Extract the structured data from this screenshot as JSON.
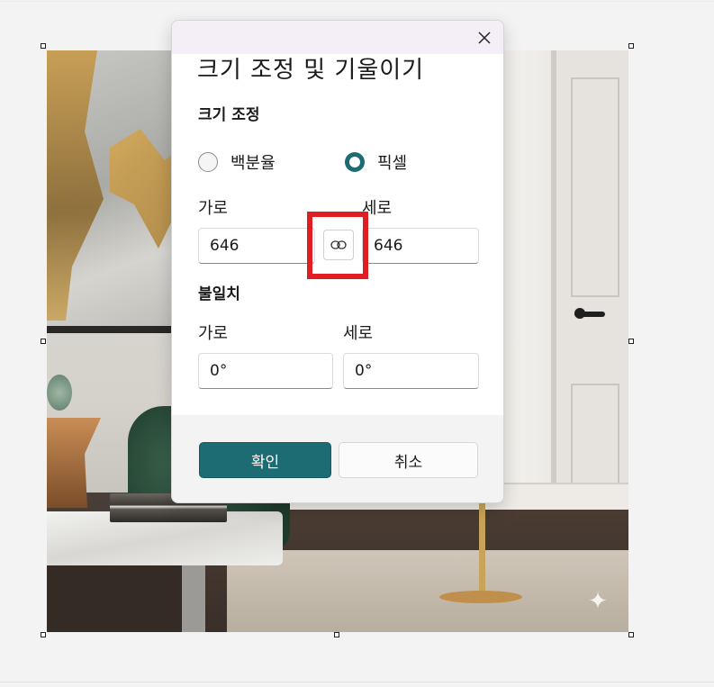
{
  "dialog": {
    "title": "크기 조정 및 기울이기",
    "resize": {
      "heading": "크기 조정",
      "options": [
        {
          "label": "백분율",
          "selected": false
        },
        {
          "label": "픽셀",
          "selected": true
        }
      ],
      "width_label": "가로",
      "height_label": "세로",
      "width_value": "646",
      "height_value": "646"
    },
    "skew": {
      "heading": "불일치",
      "horizontal_label": "가로",
      "vertical_label": "세로",
      "horizontal_value": "0°",
      "vertical_value": "0°"
    },
    "ok_label": "확인",
    "cancel_label": "취소"
  },
  "icons": {
    "close": "close-icon",
    "link": "link-icon",
    "sparkle": "sparkle-icon"
  },
  "colors": {
    "accent": "#1d6b73",
    "highlight": "#e01d23",
    "titlebar": "#f4eef6"
  }
}
